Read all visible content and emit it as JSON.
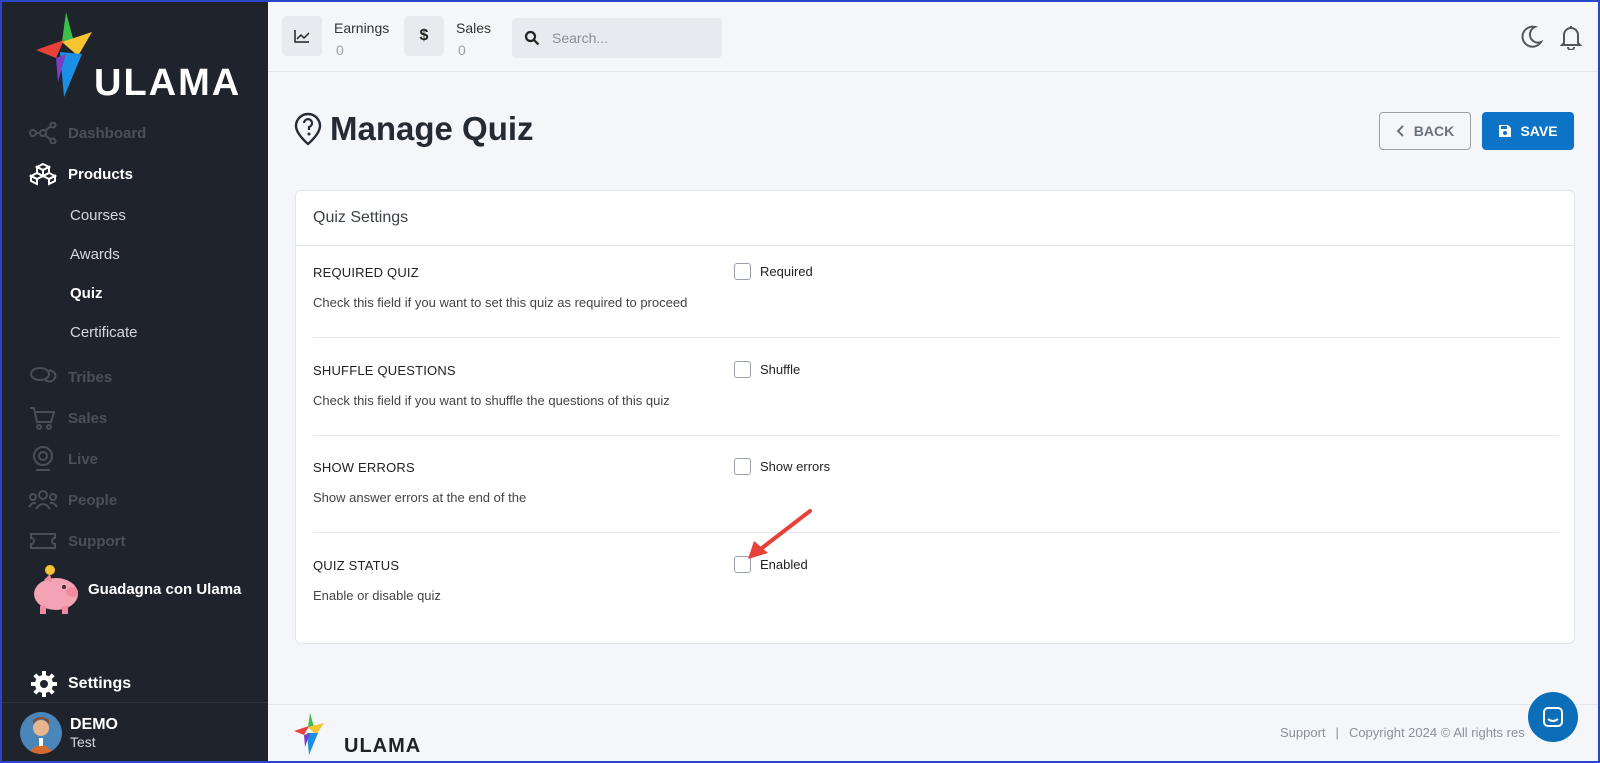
{
  "brand": {
    "name": "ULAMA"
  },
  "sidebar": {
    "nav": [
      {
        "label": "Dashboard",
        "icon": "network-icon"
      },
      {
        "label": "Products",
        "icon": "cubes-icon"
      },
      {
        "label": "Tribes",
        "icon": "chat-bubbles-icon"
      },
      {
        "label": "Sales",
        "icon": "cart-icon"
      },
      {
        "label": "Live",
        "icon": "webcam-icon"
      },
      {
        "label": "People",
        "icon": "people-icon"
      },
      {
        "label": "Support",
        "icon": "ticket-icon"
      }
    ],
    "products_sub": [
      "Courses",
      "Awards",
      "Quiz",
      "Certificate"
    ],
    "promo_label": "Guadagna con Ulama",
    "settings_label": "Settings",
    "user": {
      "name": "DEMO",
      "role": "Test"
    }
  },
  "topbar": {
    "earnings": {
      "label": "Earnings",
      "value": "0"
    },
    "sales": {
      "label": "Sales",
      "value": "0"
    },
    "search_placeholder": "Search..."
  },
  "page": {
    "title": "Manage Quiz",
    "back_label": "BACK",
    "save_label": "SAVE"
  },
  "card": {
    "title": "Quiz Settings",
    "rows": [
      {
        "title": "REQUIRED QUIZ",
        "desc": "Check this field if you want to set this quiz as required to proceed",
        "check_label": "Required",
        "checked": false
      },
      {
        "title": "SHUFFLE QUESTIONS",
        "desc": "Check this field if you want to shuffle the questions of this quiz",
        "check_label": "Shuffle",
        "checked": false
      },
      {
        "title": "SHOW ERRORS",
        "desc": "Show answer errors at the end of the",
        "check_label": "Show errors",
        "checked": false
      },
      {
        "title": "QUIZ STATUS",
        "desc": "Enable or disable quiz",
        "check_label": "Enabled",
        "checked": false
      }
    ]
  },
  "footer": {
    "support": "Support",
    "copyright": "Copyright 2024 © All rights res"
  },
  "colors": {
    "accent": "#0c73c7",
    "sidebar": "#1f232c",
    "arrow": "#e8413a"
  }
}
